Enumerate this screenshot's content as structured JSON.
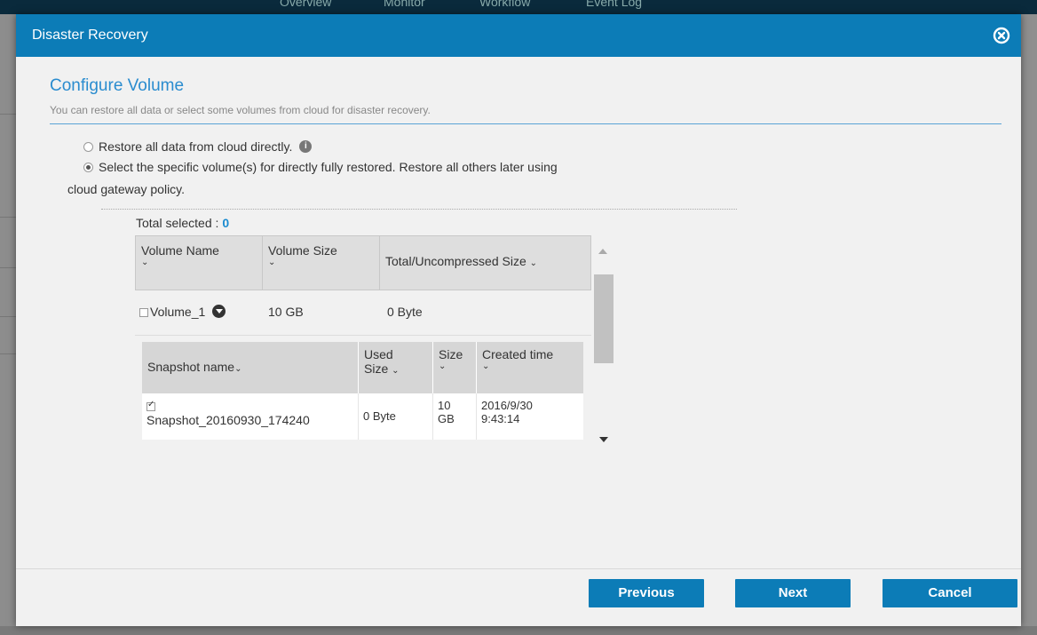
{
  "background": {
    "tabs": [
      "Overview",
      "Monitor",
      "Workflow",
      "Event Log"
    ]
  },
  "dialog": {
    "title": "Disaster Recovery",
    "close_icon": "close-circle-icon"
  },
  "section": {
    "title": "Configure Volume",
    "description": "You can restore all data or select some volumes from cloud for disaster recovery."
  },
  "options": {
    "restore_all": {
      "label": "Restore all data from cloud directly.",
      "checked": false
    },
    "select_specific": {
      "label": "Select the specific volume(s) for directly fully restored. Restore all others later using",
      "continuation": "cloud gateway policy.",
      "checked": true
    }
  },
  "total": {
    "label": "Total selected :",
    "value": "0"
  },
  "volume_table": {
    "headers": [
      "Volume Name",
      "Volume Size",
      "Total/Uncompressed Size"
    ],
    "rows": [
      {
        "name": "Volume_1",
        "size": "10 GB",
        "total": "0 Byte",
        "checked": false
      }
    ]
  },
  "snapshot_table": {
    "headers": [
      "Snapshot name",
      "Used",
      "Size",
      "Size",
      "Created time"
    ],
    "rows": [
      {
        "name": "Snapshot_20160930_174240",
        "used": "0 Byte",
        "size_line1": "10",
        "size_line2": "GB",
        "created_line1": "2016/9/30",
        "created_line2": "9:43:14",
        "checked": true
      }
    ]
  },
  "buttons": {
    "previous": "Previous",
    "next": "Next",
    "cancel": "Cancel"
  }
}
